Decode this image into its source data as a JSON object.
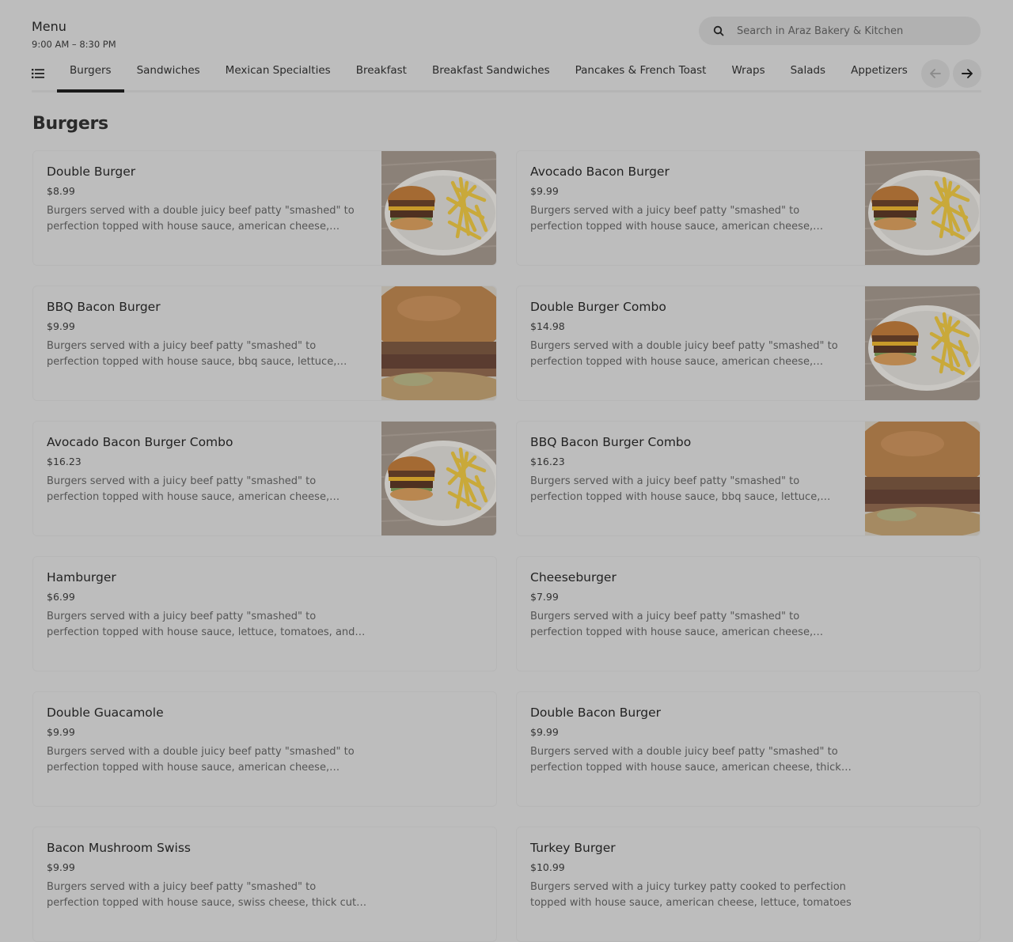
{
  "header": {
    "title": "Menu",
    "hours": "9:00 AM – 8:30 PM"
  },
  "search": {
    "placeholder": "Search in Araz Bakery & Kitchen"
  },
  "categories": [
    {
      "label": "Burgers",
      "active": true
    },
    {
      "label": "Sandwiches"
    },
    {
      "label": "Mexican Specialties"
    },
    {
      "label": "Breakfast"
    },
    {
      "label": "Breakfast Sandwiches"
    },
    {
      "label": "Pancakes & French Toast"
    },
    {
      "label": "Wraps"
    },
    {
      "label": "Salads"
    },
    {
      "label": "Appetizers"
    }
  ],
  "section": {
    "title": "Burgers"
  },
  "items": [
    {
      "name": "Double Burger",
      "price": "$8.99",
      "desc": "Burgers served with a double juicy beef patty \"smashed\" to perfection topped with house sauce, american cheese, lettuce, tomatoes, and red onions",
      "image": "burger-fries"
    },
    {
      "name": "Avocado Bacon Burger",
      "price": "$9.99",
      "desc": "Burgers served with a juicy beef patty \"smashed\" to perfection topped with house sauce, american cheese, avocado, thick cut bacon",
      "image": "burger-fries"
    },
    {
      "name": "BBQ Bacon Burger",
      "price": "$9.99",
      "desc": "Burgers served with a juicy beef patty \"smashed\" to perfection topped with house sauce, bbq sauce, lettuce, tomatoes, and onions",
      "image": "burger-closeup"
    },
    {
      "name": "Double Burger Combo",
      "price": "$14.98",
      "desc": "Burgers served with a double juicy beef patty \"smashed\" to perfection topped with house sauce, american cheese, lettuce, tomatoes",
      "image": "burger-fries"
    },
    {
      "name": "Avocado Bacon Burger Combo",
      "price": "$16.23",
      "desc": "Burgers served with a juicy beef patty \"smashed\" to perfection topped with house sauce, american cheese, avocado, thick cut bacon",
      "image": "burger-fries"
    },
    {
      "name": "BBQ Bacon Burger Combo",
      "price": "$16.23",
      "desc": "Burgers served with a juicy beef patty \"smashed\" to perfection topped with house sauce, bbq sauce, lettuce, tomatoes, and onions",
      "image": "burger-closeup"
    },
    {
      "name": "Hamburger",
      "price": "$6.99",
      "desc": "Burgers served with a juicy beef patty \"smashed\" to perfection topped with house sauce, lettuce, tomatoes, and red onions",
      "image": ""
    },
    {
      "name": "Cheeseburger",
      "price": "$7.99",
      "desc": "Burgers served with a juicy beef patty \"smashed\" to perfection topped with house sauce, american cheese, lettuce, tomatoes, and red onions",
      "image": ""
    },
    {
      "name": "Double Guacamole",
      "price": "$9.99",
      "desc": "Burgers served with a double juicy beef patty \"smashed\" to perfection topped with house sauce, american cheese, lettuce, guacamole",
      "image": ""
    },
    {
      "name": "Double Bacon Burger",
      "price": "$9.99",
      "desc": "Burgers served with a double juicy beef patty \"smashed\" to perfection topped with house sauce, american cheese, thick cut bacon",
      "image": ""
    },
    {
      "name": "Bacon Mushroom Swiss",
      "price": "$9.99",
      "desc": "Burgers served with a juicy beef patty \"smashed\" to perfection topped with house sauce, swiss cheese, thick cut bacon",
      "image": ""
    },
    {
      "name": "Turkey Burger",
      "price": "$10.99",
      "desc": "Burgers served with a juicy turkey patty cooked to perfection topped with house sauce, american cheese, lettuce, tomatoes",
      "image": ""
    }
  ]
}
